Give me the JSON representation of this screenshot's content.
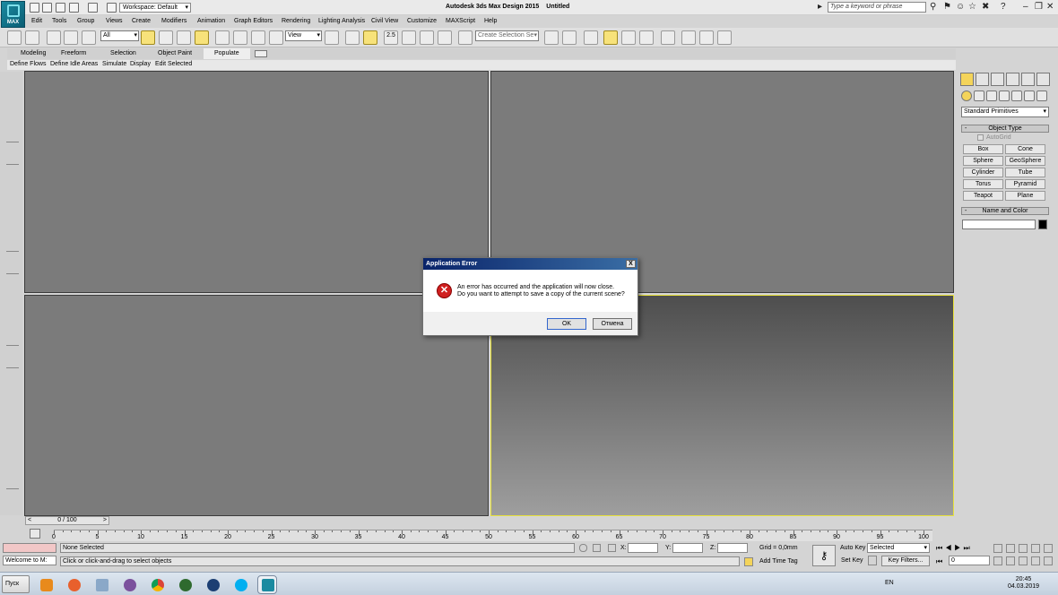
{
  "app": {
    "logo_label": "MAX",
    "title": "Autodesk 3ds Max Design 2015",
    "document": "Untitled"
  },
  "workspace": {
    "label": "Workspace: Default"
  },
  "search": {
    "placeholder": "Type a keyword or phrase"
  },
  "menu": [
    "Edit",
    "Tools",
    "Group",
    "Views",
    "Create",
    "Modifiers",
    "Animation",
    "Graph Editors",
    "Rendering",
    "Lighting Analysis",
    "Civil View",
    "Customize",
    "MAXScript",
    "Help"
  ],
  "toolbar": {
    "filter_value": "All",
    "refcoord_value": "View",
    "snap_label": "2.5",
    "selection_set_placeholder": "Create Selection Se"
  },
  "ribbon": {
    "tabs": [
      "Modeling",
      "Freeform",
      "Selection",
      "Object Paint",
      "Populate"
    ],
    "subtabs": [
      "Define Flows",
      "Define Idle Areas",
      "Simulate",
      "Display",
      "Edit Selected"
    ]
  },
  "command_panel": {
    "category": "Standard Primitives",
    "object_type_title": "Object Type",
    "autogrid": "AutoGrid",
    "buttons": [
      "Box",
      "Cone",
      "Sphere",
      "GeoSphere",
      "Cylinder",
      "Tube",
      "Torus",
      "Pyramid",
      "Teapot",
      "Plane"
    ],
    "name_color_title": "Name and Color"
  },
  "timeline": {
    "frame_readout": "0 / 100",
    "prev": "<",
    "next": ">",
    "ticks": [
      "0",
      "5",
      "10",
      "15",
      "20",
      "25",
      "30",
      "35",
      "40",
      "45",
      "50",
      "55",
      "60",
      "65",
      "70",
      "75",
      "80",
      "85",
      "90",
      "95",
      "100"
    ]
  },
  "status": {
    "maxscript_listener": "Welcome to M:",
    "selection": "None Selected",
    "prompt": "Click or click-and-drag to select objects",
    "x_label": "X:",
    "y_label": "Y:",
    "z_label": "Z:",
    "grid": "Grid = 0,0mm",
    "add_time_tag": "Add Time Tag",
    "auto_key": "Auto Key",
    "set_key": "Set Key",
    "key_mode_value": "Selected",
    "key_filters": "Key Filters...",
    "frame_value": "0"
  },
  "dialog": {
    "title": "Application Error",
    "close": "X",
    "message_line1": "An error has occurred and the application will now close.",
    "message_line2": "Do you want to attempt to save a copy of the current scene?",
    "ok": "OK",
    "cancel": "Отмена"
  },
  "taskbar": {
    "start": "Пуск",
    "lang": "EN",
    "time": "20:45",
    "date": "04.03.2019"
  },
  "colors": {
    "accent": "#f4d45a",
    "viewport_border_active": "#e8e23a",
    "dialog_title": "#0a246a",
    "error": "#d02020"
  }
}
